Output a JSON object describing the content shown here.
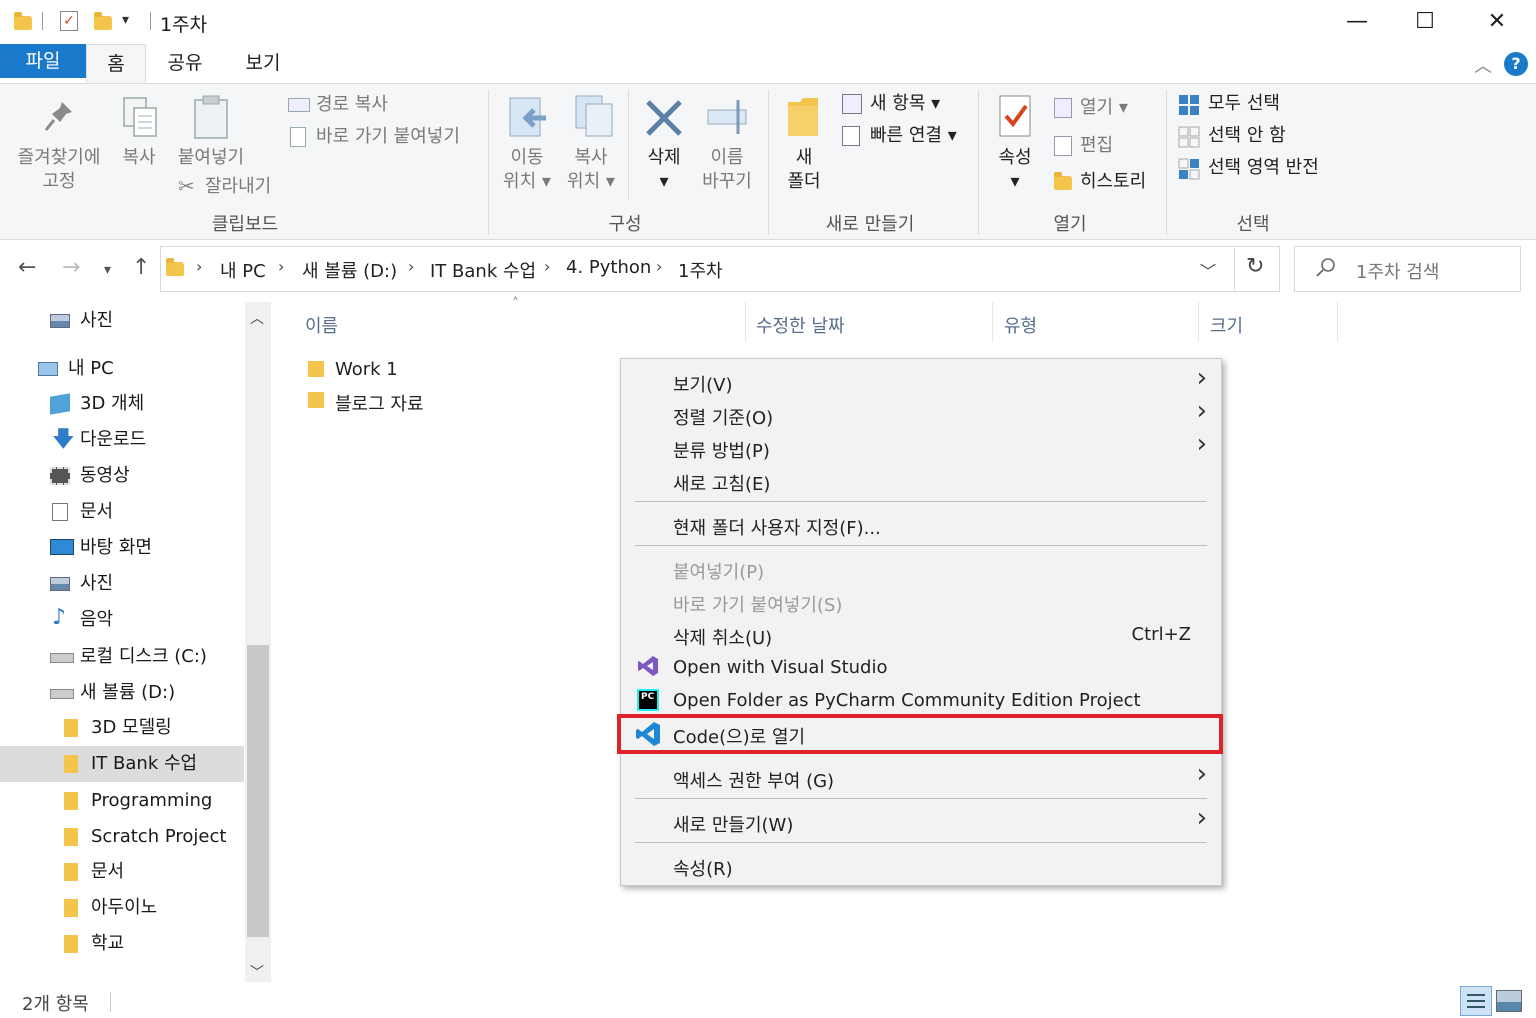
{
  "window": {
    "title": "1주차",
    "minimize": "—",
    "maximize": "☐",
    "close": "✕"
  },
  "tabs": {
    "file": "파일",
    "home": "홈",
    "share": "공유",
    "view": "보기"
  },
  "ribbon": {
    "clipboard": {
      "pin": [
        "즐겨찾기에",
        "고정"
      ],
      "copy": "복사",
      "paste": "붙여넣기",
      "copy_path": "경로 복사",
      "paste_shortcut": "바로 가기 붙여넣기",
      "cut": "잘라내기",
      "title": "클립보드"
    },
    "organize": {
      "move": [
        "이동",
        "위치"
      ],
      "copy_to": [
        "복사",
        "위치"
      ],
      "delete": "삭제",
      "rename": [
        "이름",
        "바꾸기"
      ],
      "title": "구성"
    },
    "new": {
      "new_folder": [
        "새",
        "폴더"
      ],
      "new_item": "새 항목",
      "easy_access": "빠른 연결",
      "title": "새로 만들기"
    },
    "open": {
      "properties": "속성",
      "open": "열기",
      "edit": "편집",
      "history": "히스토리",
      "title": "열기"
    },
    "select": {
      "select_all": "모두 선택",
      "select_none": "선택 안 함",
      "invert": "선택 영역 반전",
      "title": "선택"
    }
  },
  "address": {
    "crumbs": [
      "내 PC",
      "새 볼륨 (D:)",
      "IT Bank 수업",
      "4. Python",
      "1주차"
    ],
    "search_placeholder": "1주차 검색"
  },
  "nav_pane": {
    "items": [
      {
        "label": "사진",
        "icon": "pictures-icon"
      },
      {
        "label": "내 PC",
        "icon": "pc-icon"
      },
      {
        "label": "3D 개체",
        "icon": "3d-objects-icon"
      },
      {
        "label": "다운로드",
        "icon": "download-icon"
      },
      {
        "label": "동영상",
        "icon": "video-icon"
      },
      {
        "label": "문서",
        "icon": "document-icon"
      },
      {
        "label": "바탕 화면",
        "icon": "desktop-icon"
      },
      {
        "label": "사진",
        "icon": "pictures-icon"
      },
      {
        "label": "음악",
        "icon": "music-icon"
      },
      {
        "label": "로컬 디스크 (C:)",
        "icon": "drive-icon"
      },
      {
        "label": "새 볼륨 (D:)",
        "icon": "drive-icon"
      },
      {
        "label": "3D 모델링",
        "icon": "folder-icon"
      },
      {
        "label": "IT Bank 수업",
        "icon": "folder-icon"
      },
      {
        "label": "Programming",
        "icon": "folder-icon"
      },
      {
        "label": "Scratch Project",
        "icon": "folder-icon"
      },
      {
        "label": "문서",
        "icon": "folder-icon"
      },
      {
        "label": "아두이노",
        "icon": "folder-icon"
      },
      {
        "label": "학교",
        "icon": "folder-icon"
      }
    ]
  },
  "columns": {
    "name": "이름",
    "modified": "수정한 날짜",
    "type": "유형",
    "size": "크기"
  },
  "files": [
    "Work 1",
    "블로그 자료"
  ],
  "context_menu": {
    "view": "보기(V)",
    "sort": "정렬 기준(O)",
    "group": "분류 방법(P)",
    "refresh": "새로 고침(E)",
    "customize": "현재 폴더 사용자 지정(F)...",
    "paste": "붙여넣기(P)",
    "paste_shortcut": "바로 가기 붙여넣기(S)",
    "undo": "삭제 취소(U)",
    "undo_shortcut": "Ctrl+Z",
    "open_vs": "Open with Visual Studio",
    "open_pycharm": "Open Folder as PyCharm Community Edition Project",
    "open_code": "Code(으)로 열기",
    "access": "액세스 권한 부여 (G)",
    "new": "새로 만들기(W)",
    "properties": "속성(R)"
  },
  "status": {
    "count": "2개 항목"
  },
  "colors": {
    "accent": "#1979ca",
    "highlight": "#e0222a"
  }
}
